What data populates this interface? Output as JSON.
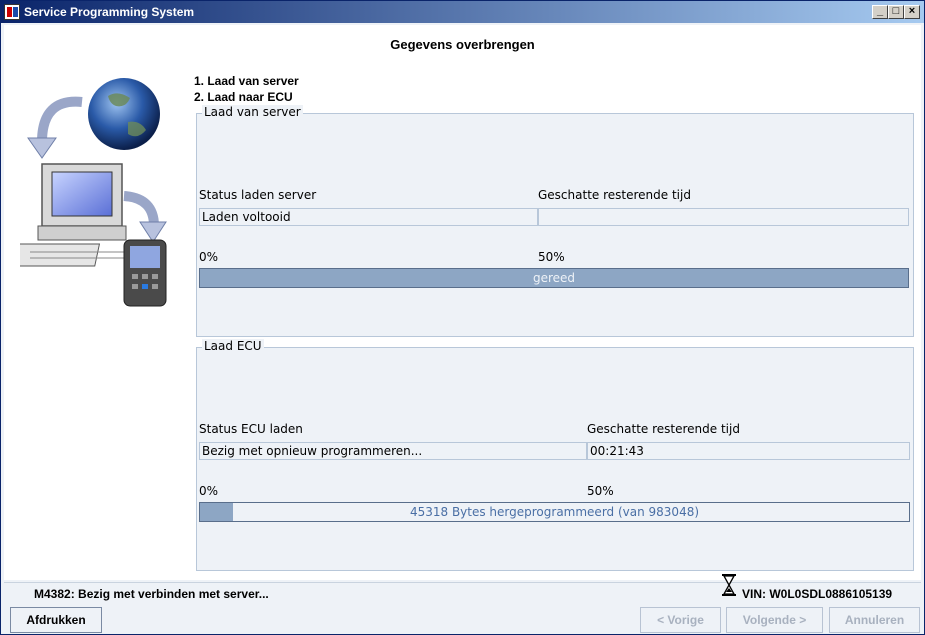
{
  "window": {
    "title": "Service Programming System",
    "controls": {
      "minimize": "_",
      "maximize": "□",
      "close": "×"
    }
  },
  "page": {
    "heading": "Gegevens overbrengen",
    "steps": [
      "1. Laad van server",
      "2. Laad naar ECU"
    ]
  },
  "server_group": {
    "title": "Laad van server",
    "status_label": "Status laden server",
    "time_label": "Geschatte resterende tijd",
    "status_value": "Laden voltooid",
    "time_value": "",
    "scale_start": "0%",
    "scale_mid": "50%",
    "progress_text": "gereed",
    "progress_fraction": 1.0
  },
  "ecu_group": {
    "title": "Laad ECU",
    "status_label": "Status ECU laden",
    "time_label": "Geschatte resterende tijd",
    "status_value": "Bezig met opnieuw programmeren...",
    "time_value": "00:21:43",
    "scale_start": "0%",
    "scale_mid": "50%",
    "progress_text": "45318 Bytes hergeprogrammeerd (van 983048)",
    "progress_fraction": 0.046
  },
  "statusbar": {
    "message": "M4382: Bezig met verbinden met server...",
    "vin": "VIN: W0L0SDL0886105139"
  },
  "buttons": {
    "print": "Afdrukken",
    "previous": "< Vorige",
    "next": "Volgende >",
    "cancel": "Annuleren"
  },
  "colors": {
    "progress_fill": "#8da6c4",
    "panel_bg": "#eef2f7",
    "title_gradient_start": "#0a246a"
  },
  "icons": [
    "app-icon",
    "hourglass-icon",
    "globe-icon",
    "computer-icon",
    "scan-tool-icon",
    "arrow-icon"
  ]
}
